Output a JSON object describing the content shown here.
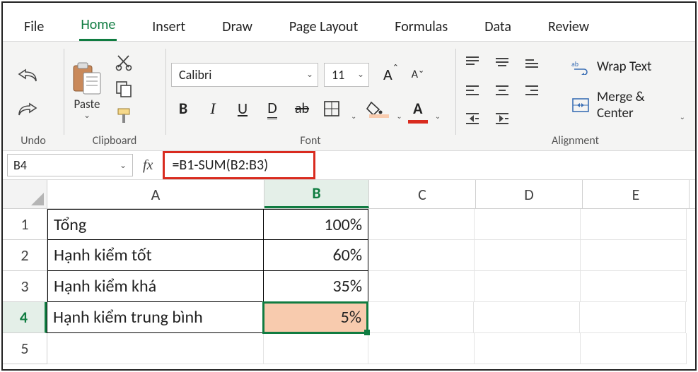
{
  "tabs": {
    "items": [
      "File",
      "Home",
      "Insert",
      "Draw",
      "Page Layout",
      "Formulas",
      "Data",
      "Review"
    ],
    "active_index": 1
  },
  "groups": {
    "undo": "Undo",
    "clipboard": "Clipboard",
    "font": "Font",
    "alignment": "Alignment"
  },
  "clipboard": {
    "paste_label": "Paste"
  },
  "font": {
    "name": "Calibri",
    "size": "11"
  },
  "alignment": {
    "wrap_label": "Wrap Text",
    "merge_label": "Merge & Center"
  },
  "formula_bar": {
    "name_box": "B4",
    "fx_label": "fx",
    "formula": "=B1-SUM(B2:B3)"
  },
  "sheet": {
    "columns": [
      "A",
      "B",
      "C",
      "D",
      "E"
    ],
    "active_column": "B",
    "active_row": "4",
    "rows": [
      {
        "n": "1",
        "A": "Tổng",
        "B": "100%"
      },
      {
        "n": "2",
        "A": "Hạnh kiểm tốt",
        "B": "60%"
      },
      {
        "n": "3",
        "A": "Hạnh kiểm khá",
        "B": "35%"
      },
      {
        "n": "4",
        "A": "Hạnh kiểm trung bình",
        "B": "5%"
      },
      {
        "n": "5",
        "A": "",
        "B": ""
      }
    ]
  }
}
